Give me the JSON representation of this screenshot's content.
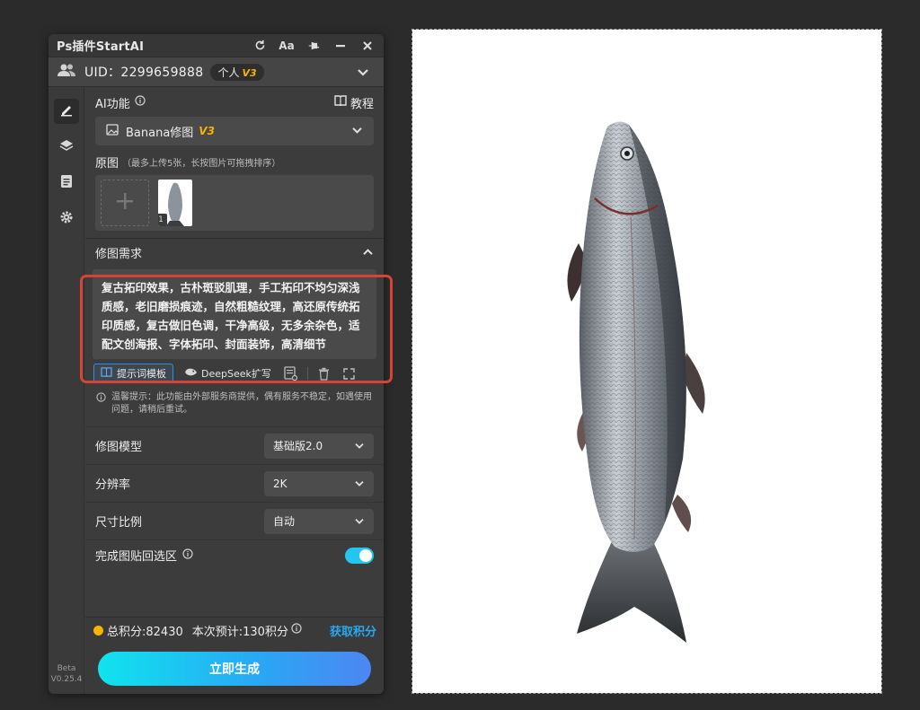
{
  "window": {
    "title": "Ps插件StartAI",
    "titlebar_icons": [
      "refresh-icon",
      "font-size-icon",
      "pin-icon",
      "minimize-icon",
      "close-icon"
    ],
    "font_button_label": "Aa"
  },
  "user": {
    "uid_text": "UID：2299659888",
    "plan_label": "个人",
    "plan_version": "V3"
  },
  "sidebar": {
    "items": [
      "edit-icon",
      "layers-icon",
      "document-icon",
      "gear-icon"
    ],
    "beta_label": "Beta",
    "version": "V0.25.4"
  },
  "ai_function": {
    "label": "AI功能",
    "tutorial_label": "教程",
    "selected": "Banana修图",
    "selected_version": "V3"
  },
  "source_image": {
    "label": "原图",
    "hint": "（最多上传5张，长按图片可拖拽排序）",
    "thumb_index": "1"
  },
  "edit_request": {
    "label": "修图需求",
    "prompt": "复古拓印效果，古朴斑驳肌理，手工拓印不均匀深浅质感，老旧磨损痕迹，自然粗糙纹理，高还原传统拓印质感，复古做旧色调，干净高级，无多余杂色，适配文创海报、字体拓印、封面装饰，高清细节",
    "template_button": "提示词模板",
    "deepseek_button": "DeepSeek扩写"
  },
  "notice": {
    "text": "温馨提示：此功能由外部服务商提供，偶有服务不稳定，如遇使用问题，请稍后重试。"
  },
  "options": {
    "model_label": "修图模型",
    "model_value": "基础版2.0",
    "resolution_label": "分辨率",
    "resolution_value": "2K",
    "ratio_label": "尺寸比例",
    "ratio_value": "自动",
    "paste_back_label": "完成图贴回选区",
    "paste_back_on": true
  },
  "footer": {
    "total_points": "总积分:82430",
    "estimate": "本次预计:130积分",
    "get_points": "获取积分",
    "generate_button": "立即生成"
  },
  "colors": {
    "accent_gold": "#f5b400",
    "accent_cyan": "#24c6f0",
    "link_blue": "#29a8f0",
    "highlight_red": "#d64533"
  }
}
